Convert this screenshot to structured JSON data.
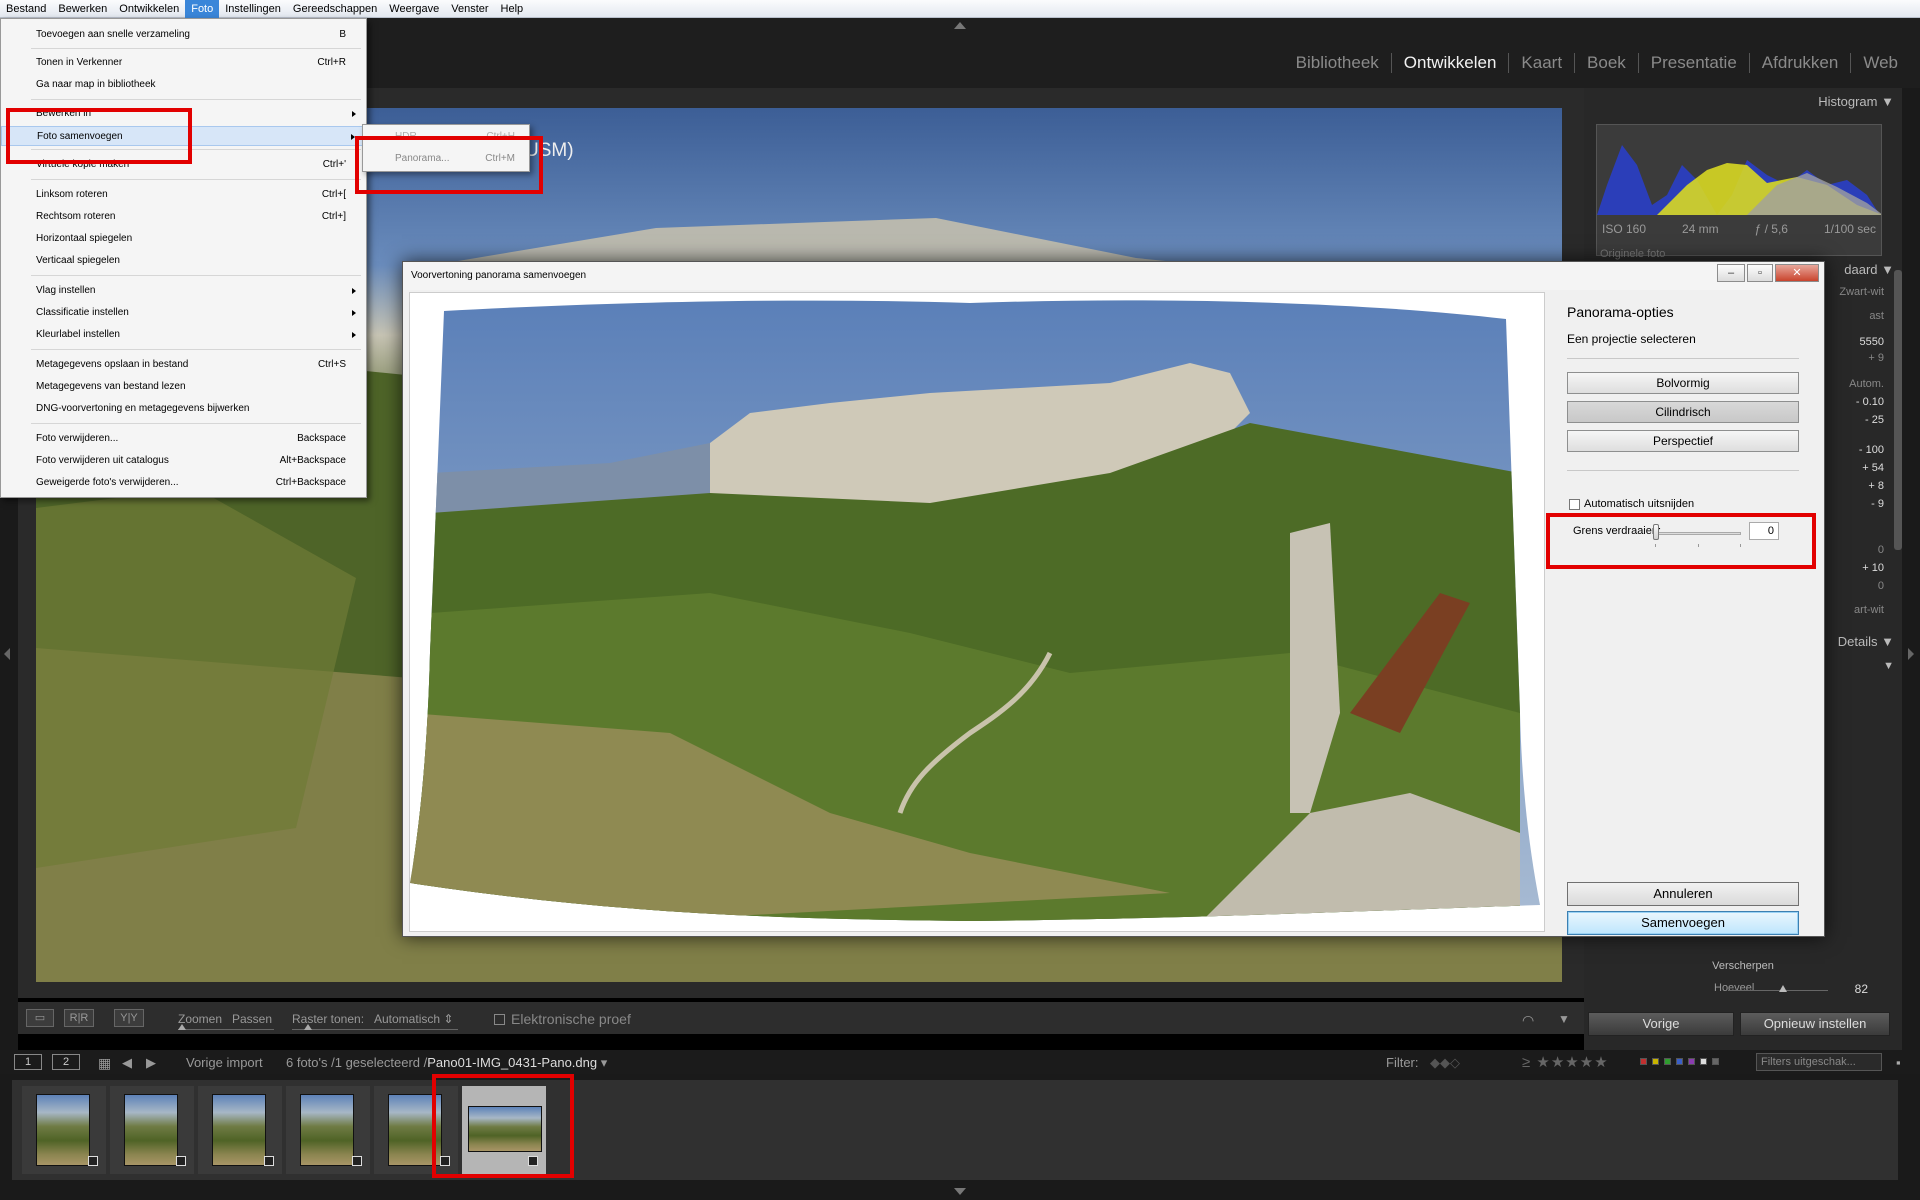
{
  "os_menu": [
    "Bestand",
    "Bewerken",
    "Ontwikkelen",
    "Foto",
    "Instellingen",
    "Gereedschappen",
    "Weergave",
    "Venster",
    "Help"
  ],
  "os_menu_active": "Foto",
  "modules": [
    "Bibliotheek",
    "Ontwikkelen",
    "Kaart",
    "Boek",
    "Presentatie",
    "Afdrukken",
    "Web"
  ],
  "active_module": "Ontwikkelen",
  "photo_title_fragment": "USM)",
  "foto_menu": {
    "items": [
      {
        "label": "Toevoegen aan snelle verzameling",
        "shortcut": "B"
      },
      {
        "label": "Tonen in Verkenner",
        "shortcut": "Ctrl+R"
      },
      {
        "label": "Ga naar map in bibliotheek",
        "shortcut": ""
      },
      {
        "label": "Bewerken in",
        "shortcut": ""
      },
      {
        "label": "Foto samenvoegen",
        "shortcut": ""
      },
      {
        "label": "Virtuele kopie maken",
        "shortcut": "Ctrl+'"
      },
      {
        "label": "Linksom roteren",
        "shortcut": "Ctrl+["
      },
      {
        "label": "Rechtsom roteren",
        "shortcut": "Ctrl+]"
      },
      {
        "label": "Horizontaal spiegelen",
        "shortcut": ""
      },
      {
        "label": "Verticaal spiegelen",
        "shortcut": ""
      },
      {
        "label": "Vlag instellen",
        "shortcut": ""
      },
      {
        "label": "Classificatie instellen",
        "shortcut": ""
      },
      {
        "label": "Kleurlabel instellen",
        "shortcut": ""
      },
      {
        "label": "Metagegevens opslaan in bestand",
        "shortcut": "Ctrl+S"
      },
      {
        "label": "Metagegevens van bestand lezen",
        "shortcut": ""
      },
      {
        "label": "DNG-voorvertoning en metagegevens bijwerken",
        "shortcut": ""
      },
      {
        "label": "Foto verwijderen...",
        "shortcut": "Backspace"
      },
      {
        "label": "Foto verwijderen uit catalogus",
        "shortcut": "Alt+Backspace"
      },
      {
        "label": "Geweigerde foto's verwijderen...",
        "shortcut": "Ctrl+Backspace"
      }
    ],
    "submenu": [
      {
        "label": "HDR...",
        "shortcut": "Ctrl+H"
      },
      {
        "label": "Panorama...",
        "shortcut": "Ctrl+M"
      }
    ]
  },
  "right_panel": {
    "histogram_label": "Histogram",
    "iso": "ISO 160",
    "focal": "24 mm",
    "aperture": "ƒ / 5,6",
    "shutter": "1/100 sec",
    "original_photo": "Originele foto",
    "frag_standaard": "daard",
    "frag_zwartwit": "Zwart-wit",
    "frag_ast": "ast",
    "values": [
      "5550",
      "+ 9",
      "- 0.10",
      "- 25",
      "- 100",
      "+ 54",
      "+ 8",
      "- 9",
      "0",
      "+ 10",
      "0"
    ],
    "frag_autom": "Autom.",
    "frag_zwartwit2": "art-wit",
    "frag_details": "Details",
    "sharpen_label": "Verscherpen",
    "amount_label": "Hoeveel",
    "amount_value": "82",
    "amount_level": 0.55,
    "prev_button": "Vorige",
    "reset_button": "Opnieuw instellen"
  },
  "toolbar": {
    "zoom": "Zoomen",
    "fit": "Passen",
    "grid": "Raster tonen:",
    "grid_value": "Automatisch",
    "proof": "Elektronische proef"
  },
  "film_header": {
    "view1": "1",
    "view2": "2",
    "source": "Vorige import",
    "count": "6 foto's /1 geselecteerd /",
    "filename": "Pano01-IMG_0431-Pano.dng",
    "filter_label": "Filter:",
    "stars": "≥ ★★★★★",
    "filter_select": "Filters uitgeschak..."
  },
  "swatch_colors": [
    "#c23030",
    "#c8b400",
    "#2f9d2f",
    "#3a5fc8",
    "#8a3cb0",
    "#dddddd",
    "#666666"
  ],
  "dialog": {
    "title": "Voorvertoning panorama samenvoegen",
    "options_title": "Panorama-opties",
    "projection_label": "Een projectie selecteren",
    "projections": [
      "Bolvormig",
      "Cilindrisch",
      "Perspectief"
    ],
    "active_projection": "Cilindrisch",
    "auto_crop": "Automatisch uitsnijden",
    "auto_crop_checked": false,
    "warp_label": "Grens verdraaien:",
    "warp_value": "0",
    "cancel": "Annuleren",
    "merge": "Samenvoegen"
  }
}
